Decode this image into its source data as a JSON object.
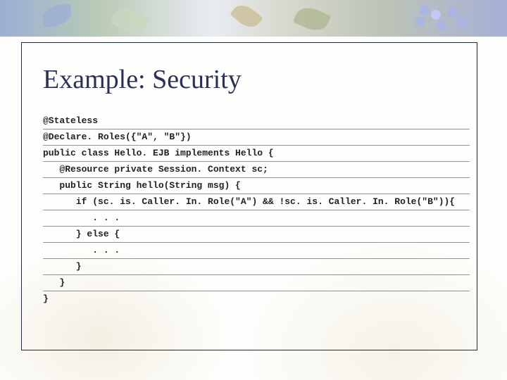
{
  "title": "Example: Security",
  "code": {
    "l0": "@Stateless",
    "l1": "@Declare. Roles({\"A\", \"B\"})",
    "l2": "public class Hello. EJB implements Hello {",
    "l3": "   @Resource private Session. Context sc;",
    "l4": "   public String hello(String msg) {",
    "l5": "      if (sc. is. Caller. In. Role(\"A\") && !sc. is. Caller. In. Role(\"B\")){",
    "l6": "         . . .",
    "l7": "      } else {",
    "l8": "         . . .",
    "l9": "      }",
    "l10": "   }",
    "l11": "}"
  }
}
